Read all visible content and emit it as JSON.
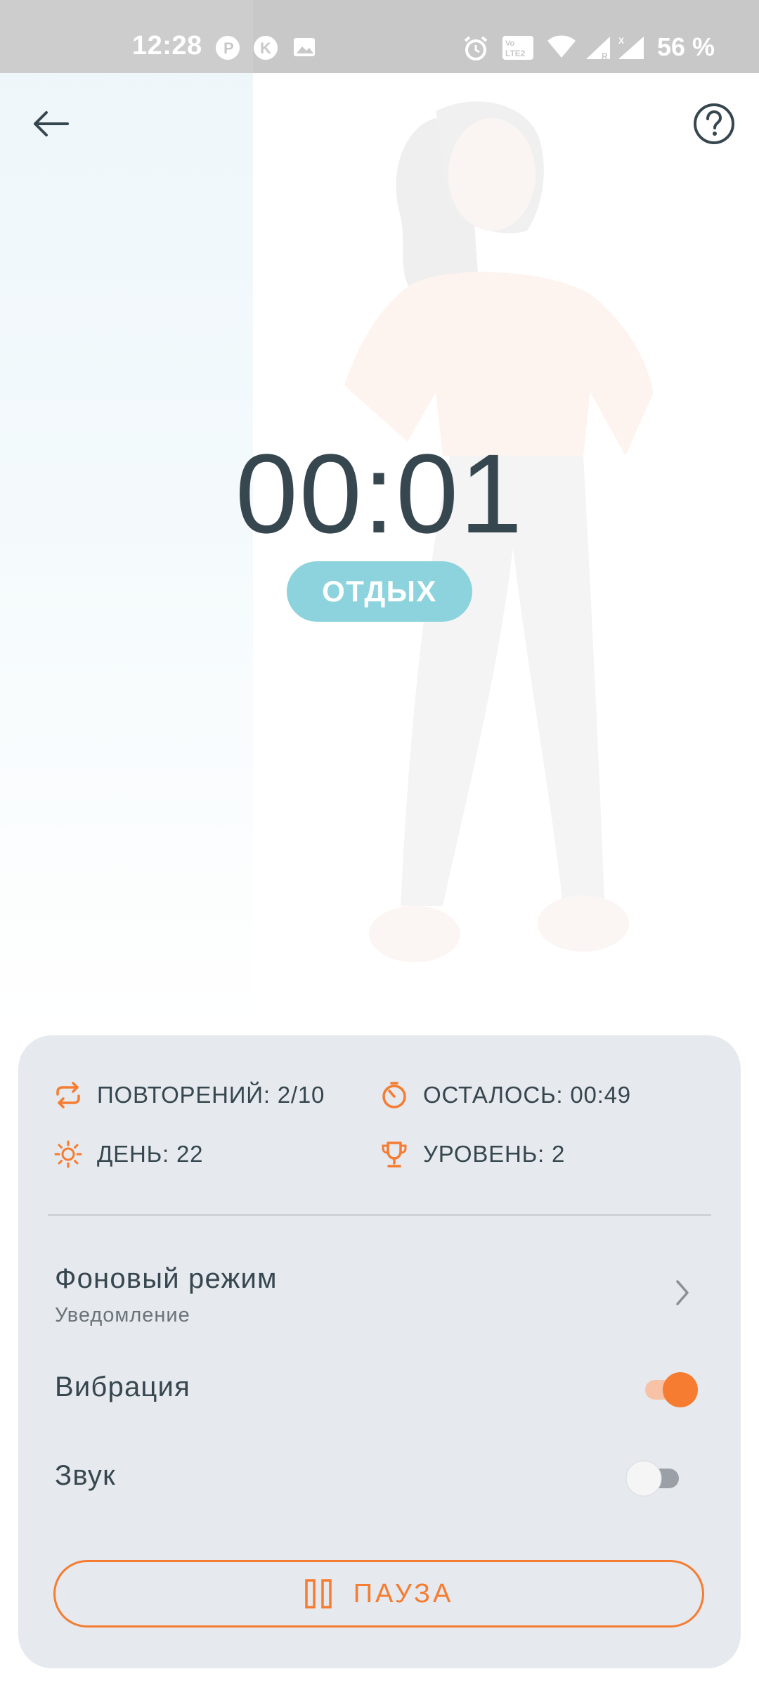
{
  "status_bar": {
    "time": "12:28",
    "battery": "56 %",
    "icons": [
      "parking-icon",
      "k-app-icon",
      "image-icon",
      "alarm-icon",
      "volte-icon",
      "wifi-icon",
      "signal-icon",
      "signal-x-icon"
    ]
  },
  "toolbar": {
    "back_icon": "arrow-left-icon",
    "help_icon": "question-circle-icon"
  },
  "timer": {
    "value": "00:01",
    "phase": "ОТДЫХ"
  },
  "stats": {
    "repetitions": "ПОВТОРЕНИЙ: 2/10",
    "remaining": "ОСТАЛОСЬ: 00:49",
    "day": "ДЕНЬ: 22",
    "level": "УРОВЕНЬ: 2"
  },
  "settings": {
    "background_mode": {
      "title": "Фоновый режим",
      "value": "Уведомление"
    },
    "vibration": {
      "label": "Вибрация",
      "on": true
    },
    "sound": {
      "label": "Звук",
      "on": false
    }
  },
  "pause_button": {
    "label": "ПАУЗА"
  },
  "colors": {
    "accent": "#f57c30",
    "text": "#37474f",
    "badge": "#8dd3de",
    "panel": "#e6e9ed"
  }
}
